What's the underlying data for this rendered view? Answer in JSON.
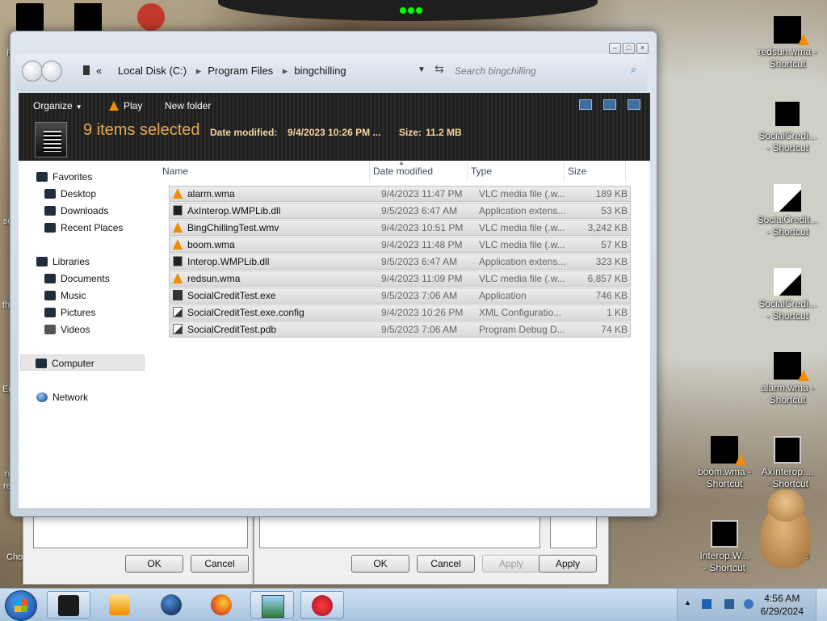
{
  "explorer": {
    "breadcrumb": [
      "Local Disk (C:)",
      "Program Files",
      "bingchilling"
    ],
    "breadcrumb_overflow": "«",
    "search_placeholder": "Search bingchilling",
    "toolbar": {
      "organize": "Organize",
      "play": "Play",
      "new_folder": "New folder"
    },
    "details": {
      "selected": "9 items selected",
      "date_label": "Date modified:",
      "date_value": "9/4/2023 10:26 PM ...",
      "size_label": "Size:",
      "size_value": "11.2 MB"
    },
    "nav_pane": {
      "favorites": "Favorites",
      "desktop": "Desktop",
      "downloads": "Downloads",
      "recent_places": "Recent Places",
      "libraries": "Libraries",
      "documents": "Documents",
      "music": "Music",
      "pictures": "Pictures",
      "videos": "Videos",
      "computer": "Computer",
      "network": "Network"
    },
    "columns": {
      "name": "Name",
      "date": "Date modified",
      "type": "Type",
      "size": "Size"
    },
    "files": [
      {
        "name": "alarm.wma",
        "date": "9/4/2023 11:47 PM",
        "type": "VLC media file (.w...",
        "size": "189 KB",
        "icon": "vlc-cone-icon"
      },
      {
        "name": "AxInterop.WMPLib.dll",
        "date": "9/5/2023 6:47 AM",
        "type": "Application extens...",
        "size": "53 KB",
        "icon": "dll-icon"
      },
      {
        "name": "BingChillingTest.wmv",
        "date": "9/4/2023 10:51 PM",
        "type": "VLC media file (.w...",
        "size": "3,242 KB",
        "icon": "vlc-cone-icon"
      },
      {
        "name": "boom.wma",
        "date": "9/4/2023 11:48 PM",
        "type": "VLC media file (.w...",
        "size": "57 KB",
        "icon": "vlc-cone-icon"
      },
      {
        "name": "Interop.WMPLib.dll",
        "date": "9/5/2023 6:47 AM",
        "type": "Application extens...",
        "size": "323 KB",
        "icon": "dll-icon"
      },
      {
        "name": "redsun.wma",
        "date": "9/4/2023 11:09 PM",
        "type": "VLC media file (.w...",
        "size": "6,857 KB",
        "icon": "vlc-cone-icon"
      },
      {
        "name": "SocialCreditTest.exe",
        "date": "9/5/2023 7:06 AM",
        "type": "Application",
        "size": "746 KB",
        "icon": "exe-icon"
      },
      {
        "name": "SocialCreditTest.exe.config",
        "date": "9/4/2023 10:26 PM",
        "type": "XML Configuratio...",
        "size": "1 KB",
        "icon": "config-file-icon"
      },
      {
        "name": "SocialCreditTest.pdb",
        "date": "9/5/2023 7:06 AM",
        "type": "Program Debug D...",
        "size": "74 KB",
        "icon": "pdb-file-icon"
      }
    ]
  },
  "background_dialogs": {
    "ok": "OK",
    "cancel": "Cancel",
    "apply": "Apply"
  },
  "desktop_icons": [
    {
      "label1": "redsun.wma -",
      "label2": "Shortcut"
    },
    {
      "label1": "SocialCredi...",
      "label2": "- Shortcut"
    },
    {
      "label1": "SocialCredit...",
      "label2": "- Shortcut"
    },
    {
      "label1": "SocialCredi...",
      "label2": "- Shortcut"
    },
    {
      "label1": "alarm.wma -",
      "label2": "Shortcut"
    },
    {
      "label1": "boom.wma -",
      "label2": "Shortcut"
    },
    {
      "label1": "AxInterop....",
      "label2": "- Shortcut"
    },
    {
      "label1": "Interop.W...",
      "label2": "- Shortcut"
    },
    {
      "label1": "",
      "label2": "- Shortcut"
    }
  ],
  "left_fragments": [
    "R",
    "so",
    "th",
    "Er",
    "n",
    "re",
    "Cho"
  ],
  "taskbar": {
    "time": "4:56 AM",
    "date": "6/29/2024"
  },
  "colors": {
    "vlc_orange": "#f28c00",
    "selection_count": "#e8a94d",
    "taskbar": "#b7cde4"
  }
}
